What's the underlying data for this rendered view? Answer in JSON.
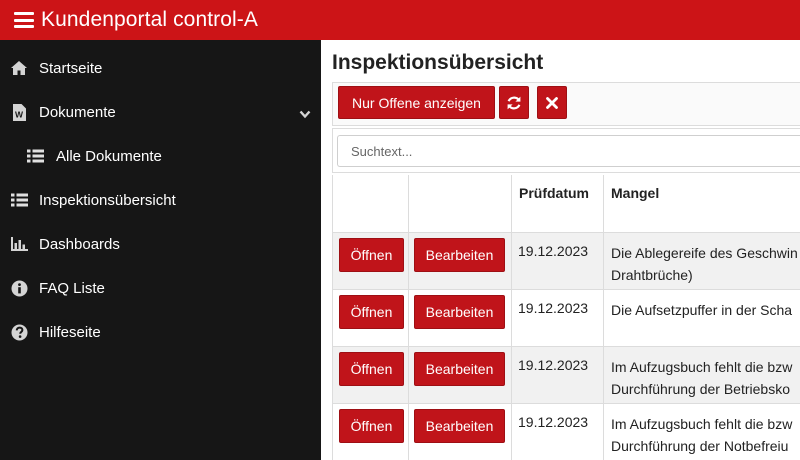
{
  "app": {
    "title": "Kundenportal control-A"
  },
  "sidebar": {
    "items": [
      {
        "label": "Startseite",
        "icon": "home-icon"
      },
      {
        "label": "Dokumente",
        "icon": "word-document-icon",
        "expandable": true
      },
      {
        "label": "Alle Dokumente",
        "icon": "list-icon",
        "sub": true
      },
      {
        "label": "Inspektionsübersicht",
        "icon": "list-icon"
      },
      {
        "label": "Dashboards",
        "icon": "bar-chart-icon"
      },
      {
        "label": "FAQ Liste",
        "icon": "info-circle-icon"
      },
      {
        "label": "Hilfeseite",
        "icon": "question-circle-icon"
      }
    ]
  },
  "main": {
    "title": "Inspektionsübersicht",
    "toolbar": {
      "filter_label": "Nur Offene anzeigen",
      "refresh_icon": "refresh-icon",
      "clear_icon": "close-icon"
    },
    "search": {
      "placeholder": "Suchtext...",
      "value": ""
    },
    "table": {
      "headers": [
        "",
        "",
        "Prüfdatum",
        "Mangel"
      ],
      "open_label": "Öffnen",
      "edit_label": "Bearbeiten",
      "rows": [
        {
          "date": "19.12.2023",
          "mangel_lines": [
            "Die Ablegereife des Geschwin",
            "Drahtbrüche)"
          ]
        },
        {
          "date": "19.12.2023",
          "mangel_lines": [
            "Die Aufsetzpuffer in der Scha"
          ]
        },
        {
          "date": "19.12.2023",
          "mangel_lines": [
            "Im Aufzugsbuch fehlt die bzw",
            "Durchführung der Betriebsko"
          ]
        },
        {
          "date": "19.12.2023",
          "mangel_lines": [
            "Im Aufzugsbuch fehlt die bzw",
            "Durchführung der Notbefreiu"
          ]
        }
      ]
    }
  },
  "colors": {
    "brand_red": "#cc1417",
    "button_red": "#c0141a",
    "sidebar_bg": "#161616"
  }
}
